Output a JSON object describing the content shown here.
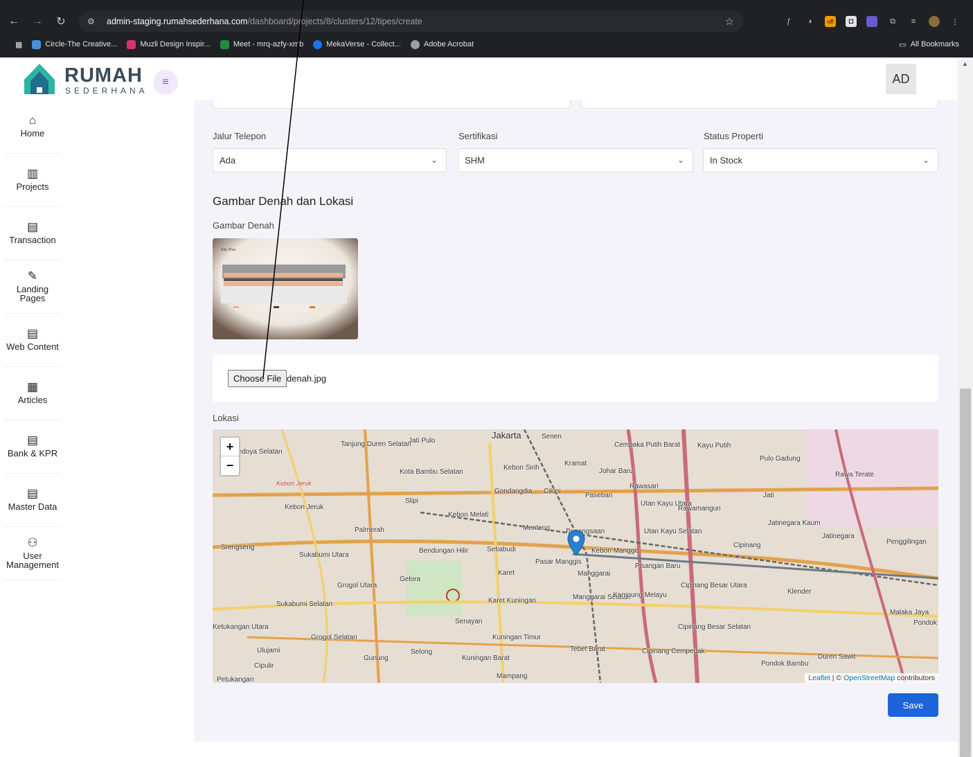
{
  "browser": {
    "url_host": "admin-staging.rumahsederhana.com",
    "url_path": "/dashboard/projects/8/clusters/12/tipes/create",
    "bookmarks": [
      {
        "label": "Circle-The Creative...",
        "color": "#4a90d9"
      },
      {
        "label": "Muzli Design Inspir...",
        "color": "#d6336c"
      },
      {
        "label": "Meet - mrq-azfy-xmb",
        "color": "#1e8e3e"
      },
      {
        "label": "MekaVerse - Collect...",
        "color": "#1a73e8"
      },
      {
        "label": "Adobe Acrobat",
        "color": "#9aa0a6"
      }
    ],
    "all_bookmarks": "All Bookmarks"
  },
  "header": {
    "logo_word": "RUMAH",
    "logo_sub": "SEDERHANA",
    "avatar": "AD"
  },
  "sidebar": {
    "items": [
      {
        "label": "Home",
        "icon": "home-icon",
        "glyph": "⌂"
      },
      {
        "label": "Projects",
        "icon": "map-icon",
        "glyph": "▥"
      },
      {
        "label": "Transaction",
        "icon": "clipboard-icon",
        "glyph": "▤"
      },
      {
        "label": "Landing Pages",
        "icon": "edit-icon",
        "glyph": "✎"
      },
      {
        "label": "Web Content",
        "icon": "clipboard-icon",
        "glyph": "▤"
      },
      {
        "label": "Articles",
        "icon": "newspaper-icon",
        "glyph": "▦"
      },
      {
        "label": "Bank & KPR",
        "icon": "clipboard-icon",
        "glyph": "▤"
      },
      {
        "label": "Master Data",
        "icon": "clipboard-icon",
        "glyph": "▤"
      },
      {
        "label": "User Management",
        "icon": "users-icon",
        "glyph": "⚇"
      }
    ]
  },
  "form": {
    "jalur_label": "Jalur Telepon",
    "jalur_value": "Ada",
    "sertifikasi_label": "Sertifikasi",
    "sertifikasi_value": "SHM",
    "status_label": "Status Properti",
    "status_value": "In Stock",
    "section_title": "Gambar Denah dan Lokasi",
    "denah_label": "Gambar Denah",
    "thumb_caption": "Site Plan",
    "choose_file": "Choose File",
    "file_name": "denah.jpg",
    "lokasi_label": "Lokasi",
    "save": "Save"
  },
  "map": {
    "zoom_in": "+",
    "zoom_out": "−",
    "attribution_leaflet": "Leaflet",
    "attribution_osm": "OpenStreetMap",
    "attribution_rest": "contributors",
    "labels": [
      {
        "t": "Jakarta",
        "c": "big"
      },
      {
        "t": "Tanjung Duren Selatan",
        "c": ""
      },
      {
        "t": "Jati Pulo",
        "c": ""
      },
      {
        "t": "Senen",
        "c": ""
      },
      {
        "t": "Cempaka Putih Barat",
        "c": ""
      },
      {
        "t": "Kayu Putih",
        "c": ""
      },
      {
        "t": "Pulo Gadung",
        "c": ""
      },
      {
        "t": "Rawa Terate",
        "c": ""
      },
      {
        "t": "Kedoya Selatan",
        "c": ""
      },
      {
        "t": "Kota Bambu Selatan",
        "c": ""
      },
      {
        "t": "Kebon Sirih",
        "c": ""
      },
      {
        "t": "Kramat",
        "c": ""
      },
      {
        "t": "Johar Baru",
        "c": ""
      },
      {
        "t": "Kebon Jeruk",
        "c": "red"
      },
      {
        "t": "Gondangdia",
        "c": ""
      },
      {
        "t": "Cikini",
        "c": ""
      },
      {
        "t": "Paseban",
        "c": ""
      },
      {
        "t": "Rawasari",
        "c": ""
      },
      {
        "t": "Jati",
        "c": ""
      },
      {
        "t": "Slipi",
        "c": ""
      },
      {
        "t": "Kebon Jeruk",
        "c": ""
      },
      {
        "t": "Utan Kayu Utara",
        "c": ""
      },
      {
        "t": "Rawamangun",
        "c": ""
      },
      {
        "t": "Kebon Melati",
        "c": ""
      },
      {
        "t": "Palmerah",
        "c": ""
      },
      {
        "t": "Menteng",
        "c": ""
      },
      {
        "t": "Pegangsaan",
        "c": ""
      },
      {
        "t": "Utan Kayu Selatan",
        "c": ""
      },
      {
        "t": "Jatinegara Kaum",
        "c": ""
      },
      {
        "t": "Jatinegara",
        "c": ""
      },
      {
        "t": "Penggilingan",
        "c": ""
      },
      {
        "t": "Srengseng",
        "c": ""
      },
      {
        "t": "Sukabumi Utara",
        "c": ""
      },
      {
        "t": "Bendungan Hilir",
        "c": ""
      },
      {
        "t": "Setiabudi",
        "c": ""
      },
      {
        "t": "Kebon Manggis",
        "c": ""
      },
      {
        "t": "Cipinang",
        "c": ""
      },
      {
        "t": "Pasar Manggis",
        "c": ""
      },
      {
        "t": "Karet",
        "c": ""
      },
      {
        "t": "Manggarai",
        "c": ""
      },
      {
        "t": "Pisangan Baru",
        "c": ""
      },
      {
        "t": "Gelora",
        "c": ""
      },
      {
        "t": "Grogol Utara",
        "c": ""
      },
      {
        "t": "Cipinang Besar Utara",
        "c": ""
      },
      {
        "t": "Klender",
        "c": ""
      },
      {
        "t": "Sukabumi Selatan",
        "c": ""
      },
      {
        "t": "Karet Kuningan",
        "c": ""
      },
      {
        "t": "Manggarai Selatan",
        "c": ""
      },
      {
        "t": "Kampung Melayu",
        "c": ""
      },
      {
        "t": "Malaka Jaya",
        "c": ""
      },
      {
        "t": "Pondok",
        "c": ""
      },
      {
        "t": "Senayan",
        "c": ""
      },
      {
        "t": "Grogol Selatan",
        "c": ""
      },
      {
        "t": "Kuningan Timur",
        "c": ""
      },
      {
        "t": "Cipinang Besar Selatan",
        "c": ""
      },
      {
        "t": "Ulujami",
        "c": ""
      },
      {
        "t": "Tebet Barat",
        "c": ""
      },
      {
        "t": "Cipinang Cempedak",
        "c": ""
      },
      {
        "t": "Gunung",
        "c": ""
      },
      {
        "t": "Selong",
        "c": ""
      },
      {
        "t": "Kuningan Barat",
        "c": ""
      },
      {
        "t": "Duren Sawit",
        "c": ""
      },
      {
        "t": "Cipulir",
        "c": ""
      },
      {
        "t": "Pondok Bambu",
        "c": ""
      },
      {
        "t": "Mampang",
        "c": ""
      },
      {
        "t": "Petukangan",
        "c": ""
      },
      {
        "t": "Ketukangan Utara",
        "c": ""
      }
    ]
  },
  "colors": {
    "primary": "#1d64db",
    "marker": "#2a81cb",
    "menu_toggle_bg": "#efe9fb"
  }
}
